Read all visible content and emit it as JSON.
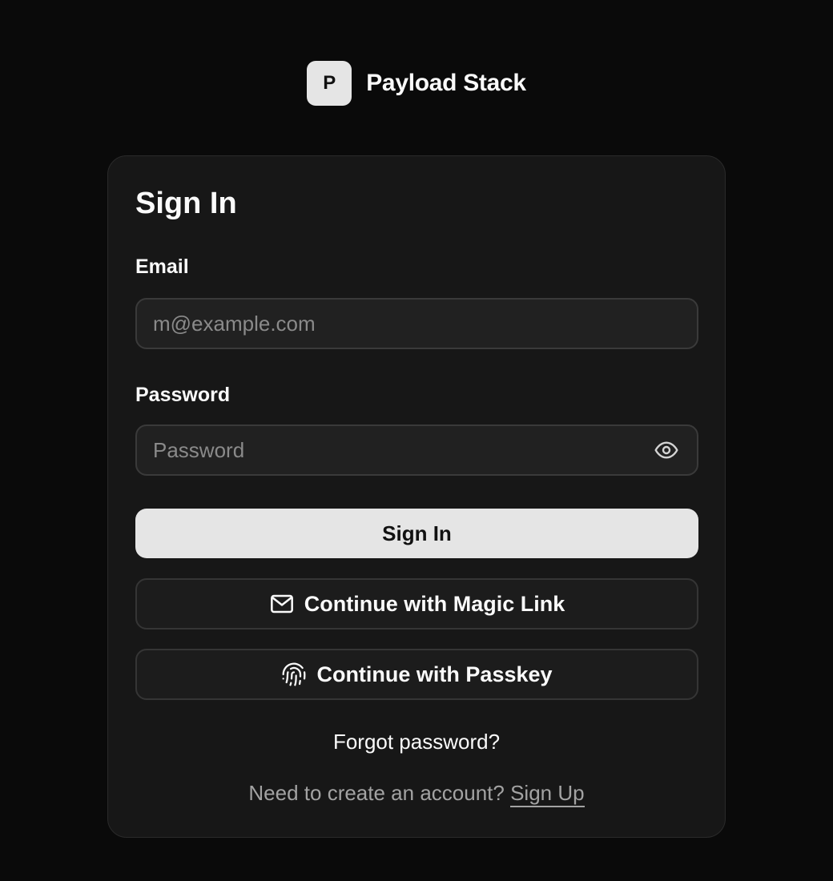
{
  "brand": {
    "logo_letter": "P",
    "name": "Payload Stack"
  },
  "signin": {
    "title": "Sign In",
    "email": {
      "label": "Email",
      "placeholder": "m@example.com",
      "value": ""
    },
    "password": {
      "label": "Password",
      "placeholder": "Password",
      "value": "",
      "toggle_icon": "eye-icon"
    },
    "submit_label": "Sign In",
    "magic_link": {
      "label": "Continue with Magic Link",
      "icon": "mail-icon"
    },
    "passkey": {
      "label": "Continue with Passkey",
      "icon": "fingerprint-icon"
    },
    "forgot_label": "Forgot password?",
    "signup_prompt": "Need to create an account?",
    "signup_link": "Sign Up"
  },
  "colors": {
    "background": "#0a0a0a",
    "card": "#171717",
    "primary_button": "#e5e5e5",
    "muted_text": "#a3a3a3"
  }
}
